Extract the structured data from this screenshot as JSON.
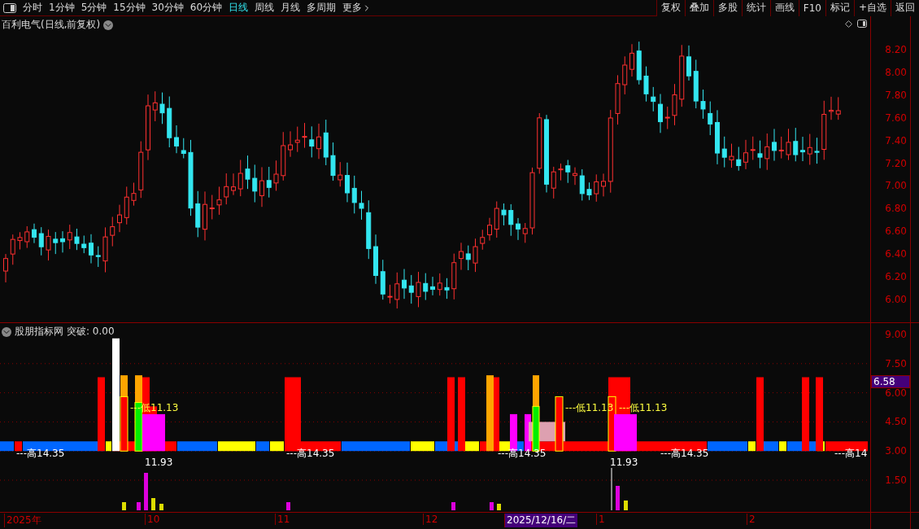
{
  "toolbar": {
    "periods": [
      {
        "label": "分时",
        "selected": false
      },
      {
        "label": "1分钟",
        "selected": false
      },
      {
        "label": "5分钟",
        "selected": false
      },
      {
        "label": "15分钟",
        "selected": false
      },
      {
        "label": "30分钟",
        "selected": false
      },
      {
        "label": "60分钟",
        "selected": false
      },
      {
        "label": "日线",
        "selected": true
      },
      {
        "label": "周线",
        "selected": false
      },
      {
        "label": "月线",
        "selected": false
      },
      {
        "label": "多周期",
        "selected": false
      }
    ],
    "more": "更多",
    "buttons": [
      "复权",
      "叠加",
      "多股",
      "统计",
      "画线",
      "F10",
      "标记",
      "+自选",
      "返回"
    ]
  },
  "main_chart": {
    "title": "百利电气(日线,前复权)",
    "price_ticks": [
      "8.20",
      "8.00",
      "7.80",
      "7.60",
      "7.40",
      "7.20",
      "7.00",
      "6.80",
      "6.60",
      "6.40",
      "6.20",
      "6.00"
    ]
  },
  "indicator": {
    "title": "股朋指标网",
    "reading": "突破: 0.00",
    "ticks": [
      "9.00",
      "7.50",
      "6.00",
      "4.50",
      "3.00",
      "1.50"
    ],
    "current_value": "6.58",
    "labels": [
      "---高14.35",
      "11.93",
      "---低11.13",
      "---高14.35",
      "---高14.35",
      "---低11.13",
      "---低11.13",
      "11.93",
      "---高14.35",
      "---高14"
    ]
  },
  "date_axis": {
    "labels": [
      {
        "text": "2025年",
        "selected": false
      },
      {
        "text": "10",
        "selected": false
      },
      {
        "text": "11",
        "selected": false
      },
      {
        "text": "12",
        "selected": false
      },
      {
        "text": "2025/12/16/二",
        "selected": true
      },
      {
        "text": "1",
        "selected": false
      },
      {
        "text": "2",
        "selected": false
      }
    ]
  }
}
